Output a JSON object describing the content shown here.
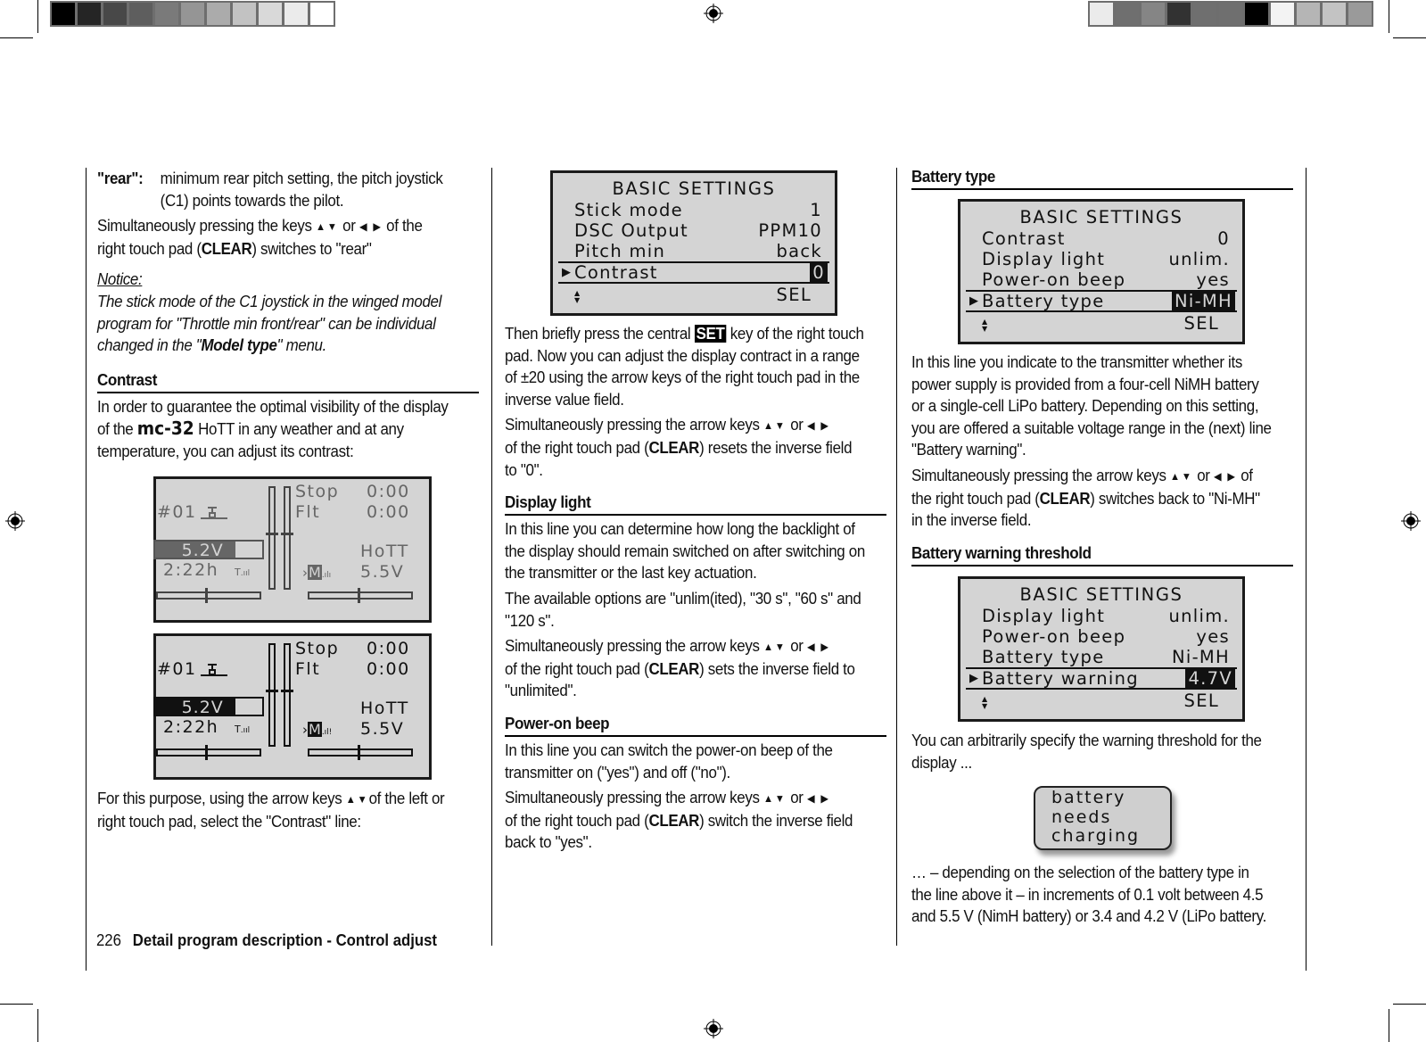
{
  "print_marks": {
    "left_swatches": [
      "#000000",
      "#252525",
      "#484848",
      "#5e5e5e",
      "#7a7a7a",
      "#959595",
      "#ababab",
      "#c2c2c2",
      "#d9d9d9",
      "#ebebeb",
      "#ffffff"
    ],
    "right_swatches": [
      "#ebebeb",
      "#6f6f6f",
      "#858585",
      "#323232",
      "#6f6f6f",
      "#6f6f6f",
      "#000000",
      "#f3f3f3",
      "#b5b5b5",
      "#c3c3c3",
      "#9a9a9a"
    ]
  },
  "left_column": {
    "rear_term": "\"rear\":",
    "rear_def_1": "minimum rear pitch setting, the pitch joystick",
    "rear_def_2": "(C1) points towards the pilot.",
    "para1_a": "Simultaneously pressing the keys",
    "para1_b": "or",
    "para1_c": "of the",
    "para1_line2_a": "right touch pad (",
    "para1_line2_b": "CLEAR",
    "para1_line2_c": ") switches to \"rear\"",
    "notice_label": "Notice:",
    "notice_1": "The stick mode of the C1 joystick in the winged model",
    "notice_2": "program for \"Throttle min front/rear\" can be individual",
    "notice_3a": "changed in the \"",
    "notice_3b": "Model type",
    "notice_3c": "\" menu.",
    "contrast_heading": "Contrast",
    "contrast_1": "In order to guarantee the optimal visibility of the display",
    "contrast_2a": "of the",
    "contrast_2b": "mc-32",
    "contrast_2c": "HoTT in any weather and at any",
    "contrast_3": "temperature, you can adjust its contrast:",
    "select_1a": "For this purpose, using the arrow keys",
    "select_1b": "of the left or",
    "select_2": "right touch pad, select the \"Contrast\" line:",
    "arrows_ud": "▲▼",
    "arrows_lr": "◀ ▶"
  },
  "main_screens": [
    {
      "variant": "low-contrast",
      "model": "#01",
      "stop_label": "Stop",
      "stop_time": "0:00",
      "flt_label": "Flt",
      "flt_time": "0:00",
      "voltage": "5.2V",
      "voltage_fill": 0.75,
      "runtime": "2:22h",
      "rf_label": "HoTT",
      "rf_voltage": "5.5V",
      "m_label": "M",
      "signal": ".ılı"
    },
    {
      "variant": "high-contrast",
      "model": "#01",
      "stop_label": "Stop",
      "stop_time": "0:00",
      "flt_label": "Flt",
      "flt_time": "0:00",
      "voltage": "5.2V",
      "voltage_fill": 0.75,
      "runtime": "2:22h",
      "rf_label": "HoTT",
      "rf_voltage": "5.5V",
      "m_label": "M",
      "signal": ".ıl!"
    }
  ],
  "middle_column": {
    "screen": {
      "title": "BASIC  SETTINGS",
      "rows": [
        {
          "label": "Stick mode",
          "value": "1"
        },
        {
          "label": "DSC Output",
          "value": "PPM10"
        },
        {
          "label": "Pitch min",
          "value": "back"
        }
      ],
      "selected": {
        "label": "Contrast",
        "value": "0"
      },
      "footer": "SEL"
    },
    "p1_a": "Then briefly press the central",
    "set_key": "SET",
    "p1_b": "key of the right touch",
    "p1_2": "pad. Now you can adjust the display contract in a range",
    "p1_3": "of ±20 using the arrow keys of the right touch pad in the",
    "p1_4": "inverse value field.",
    "p2_1a": "Simultaneously pressing the arrow keys",
    "p2_1b": "or",
    "p2_2a": "of the right touch pad (",
    "p2_2b": "CLEAR",
    "p2_2c": ") resets the inverse field",
    "p2_3": "to \"0\".",
    "display_heading": "Display light",
    "d1": "In this line you can determine how long the backlight of",
    "d2": "the display should remain switched on after switching on",
    "d3": "the transmitter or the last key actuation.",
    "d4": "The available options are \"unlim(ited), \"30 s\", \"60 s\" and",
    "d5": "\"120 s\".",
    "d6a": "Simultaneously pressing the arrow keys",
    "d6b": "or",
    "d7a": "of the right touch pad (",
    "d7b": "CLEAR",
    "d7c": ") sets the inverse field to",
    "d8": "\"unlimited\".",
    "beep_heading": "Power-on beep",
    "b1": "In this line you can switch the power-on beep of the",
    "b2": "transmitter on (\"yes\") and off (\"no\").",
    "b3a": "Simultaneously pressing the arrow keys",
    "b3b": "or",
    "b4a": "of the right touch pad (",
    "b4b": "CLEAR",
    "b4c": ") switch the inverse field",
    "b5": "back to \"yes\"."
  },
  "right_column": {
    "battery_type_heading": "Battery type",
    "screen1": {
      "title": "BASIC  SETTINGS",
      "rows": [
        {
          "label": "Contrast",
          "value": "0"
        },
        {
          "label": "Display light",
          "value": "unlim."
        },
        {
          "label": "Power-on beep",
          "value": "yes"
        }
      ],
      "selected": {
        "label": "Battery type",
        "value": "Ni-MH"
      },
      "footer": "SEL"
    },
    "t1": "In this line you indicate to the transmitter whether its",
    "t2": "power supply is provided from a four-cell NiMH battery",
    "t3": "or a single-cell LiPo battery. Depending on this setting,",
    "t4": "you are offered a suitable voltage range in the (next) line",
    "t5": "\"Battery warning\".",
    "t6a": "Simultaneously pressing the arrow keys",
    "t6b": "or",
    "t6c": "of",
    "t7a": "the right touch pad (",
    "t7b": "CLEAR",
    "t7c": ") switches back to \"Ni-MH\"",
    "t8": "in the inverse field.",
    "warning_heading": "Battery warning threshold",
    "screen2": {
      "title": "BASIC  SETTINGS",
      "rows": [
        {
          "label": "Display light",
          "value": "unlim."
        },
        {
          "label": "Power-on beep",
          "value": "yes"
        },
        {
          "label": "Battery type",
          "value": "Ni-MH"
        }
      ],
      "selected": {
        "label": "Battery warning",
        "value": "4.7V"
      },
      "footer": "SEL"
    },
    "w1": "You can arbitrarily specify the warning threshold for the",
    "w2": "display ...",
    "popup": [
      "battery",
      "needs",
      "charging"
    ],
    "w3": "… – depending on the selection of the battery type in",
    "w4": "the line above it  – in increments of 0.1 volt between 4.5",
    "w5": "and 5.5 V (NimH battery) or 3.4 and 4.2 V (LiPo battery."
  },
  "footer": {
    "page_number": "226",
    "section": "Detail program description - Control adjust"
  }
}
